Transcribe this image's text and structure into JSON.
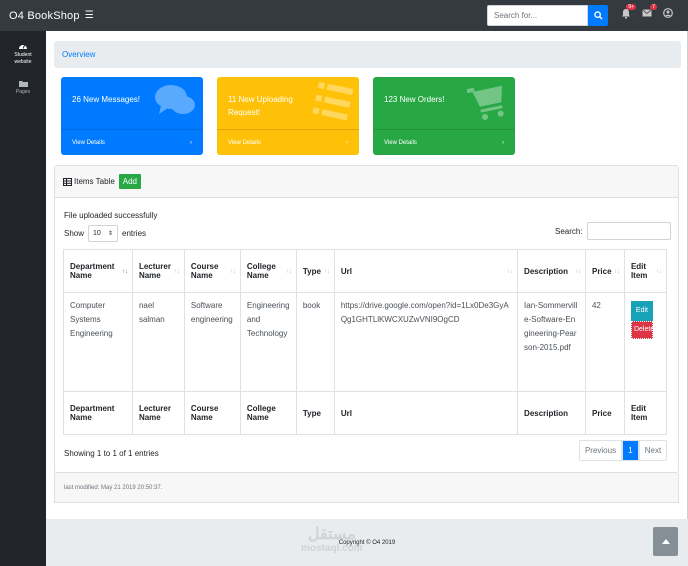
{
  "app": {
    "brand": "O4 BookShop"
  },
  "search": {
    "placeholder": "Search for..."
  },
  "nav": {
    "alerts_badge": "9+",
    "messages_badge": "7"
  },
  "sidebar": {
    "items": [
      {
        "label_line1": "Student",
        "label_line2": "website",
        "icon": "dashboard-icon"
      },
      {
        "label_line1": "Pages",
        "label_line2": "",
        "icon": "folder-icon"
      }
    ]
  },
  "breadcrumb": {
    "label": "Overview"
  },
  "cards": [
    {
      "title": "26 New Messages!",
      "footer": "View Details",
      "color": "#007bff",
      "icon": "comments-icon"
    },
    {
      "title": "11 New Uploading Request!",
      "footer": "View Details",
      "color": "#ffc107",
      "icon": "list-icon"
    },
    {
      "title": "123 New Orders!",
      "footer": "View Details",
      "color": "#28a745",
      "icon": "shopping-cart-icon"
    }
  ],
  "table_panel": {
    "title": "Items Table",
    "add_label": "Add",
    "message": "File uploaded successfully",
    "show_label": "Show",
    "entries_value": "10",
    "entries_label": "entries",
    "search_label": "Search:",
    "columns": [
      "Department Name",
      "Lecturer Name",
      "Course Name",
      "College Name",
      "Type",
      "Url",
      "Description",
      "Price",
      "Edit Item"
    ],
    "rows": [
      {
        "department": "Computer Systems Engineering",
        "lecturer": "nael salman",
        "course": "Software engineering",
        "college": "Engineering and Technology",
        "type": "book",
        "url": "https://drive.google.com/open?id=1Lx0De3GyAQg1GHTLlKWCXUZwVNI9OgCD",
        "description": "Ian-Sommerville-Software-Engineering-Pearson-2015.pdf",
        "price": "42",
        "edit_label": "Edit",
        "delete_label": "Delete"
      }
    ],
    "info": "Showing 1 to 1 of 1 entries",
    "pager": {
      "previous": "Previous",
      "current": "1",
      "next": "Next"
    },
    "last_modified": "last modified: May 21 2019 20:50:37."
  },
  "footer": {
    "copyright": "Copyright © O4 2019",
    "watermark_line1": "مستقل",
    "watermark_line2": "mostaql.com"
  }
}
